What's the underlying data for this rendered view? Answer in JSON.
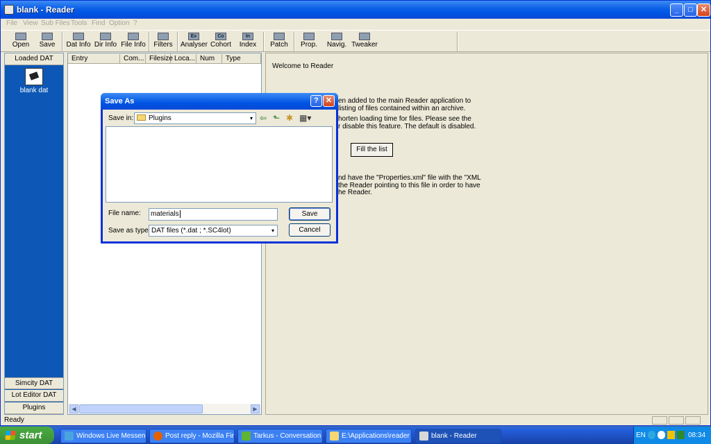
{
  "window": {
    "title": "blank - Reader",
    "min": "_",
    "max": "□",
    "close": "✕"
  },
  "menu": [
    "File",
    "View",
    "Sub Files",
    "Tools",
    "Find",
    "Option",
    "?"
  ],
  "toolbar": [
    {
      "label": "Open",
      "icon": "open-icon"
    },
    {
      "label": "Save",
      "icon": "save-icon"
    },
    {
      "label": "Dat Info",
      "icon": "dat-info-icon"
    },
    {
      "label": "Dir Info",
      "icon": "dir-info-icon"
    },
    {
      "label": "File Info",
      "icon": "file-info-icon"
    },
    {
      "label": "Filters",
      "icon": "filters-icon"
    },
    {
      "label": "Analyser",
      "icon": "analyser-icon",
      "glyph": "Ex"
    },
    {
      "label": "Cohort",
      "icon": "cohort-icon",
      "glyph": "Co"
    },
    {
      "label": "Index",
      "icon": "index-icon",
      "glyph": "In"
    },
    {
      "label": "Patch",
      "icon": "patch-icon"
    },
    {
      "label": "Prop.",
      "icon": "properties-icon"
    },
    {
      "label": "Navig.",
      "icon": "navigator-icon"
    },
    {
      "label": "Tweaker",
      "icon": "tweaker-icon"
    }
  ],
  "left_panel": {
    "header": "Loaded DAT",
    "item": "blank dat",
    "bottom": [
      "Simcity DAT",
      "Lot Editor DAT",
      "Plugins"
    ]
  },
  "list": {
    "columns": [
      "Entry",
      "Com...",
      "Filesize",
      "Loca...",
      "Num",
      "Type"
    ],
    "scroll_left": "◀",
    "scroll_right": "▶"
  },
  "info": {
    "welcome": "Welcome to Reader",
    "lines": [
      "en added to the main Reader application to",
      "listing of files contained within an archive.",
      "horten loading time for files. Please see the",
      "r disable this feature. The default is disabled.",
      "nd have the \"Properties.xml\" file with the \"XML",
      "the Reader pointing to this file in order to have",
      "he Reader."
    ],
    "fill_button": "Fill the list"
  },
  "status": "Ready",
  "dialog": {
    "title": "Save As",
    "help": "?",
    "close": "✕",
    "save_in_label": "Save in:",
    "save_in_value": "Plugins",
    "file_name_label": "File name:",
    "file_name_value": "materials",
    "save_type_label": "Save as type:",
    "save_type_value": "DAT files (*.dat ; *.SC4lot)",
    "save": "Save",
    "cancel": "Cancel",
    "nav": {
      "back": "⇦",
      "up": "⬑",
      "new_folder": "✱",
      "views": "▦▾"
    },
    "dropdown_arrow": "▾"
  },
  "taskbar": {
    "start": "start",
    "tasks": [
      {
        "label": "Windows Live Messen...",
        "icon": "messenger-icon",
        "color": "#4aa3df"
      },
      {
        "label": "Post reply - Mozilla Fir...",
        "icon": "firefox-icon",
        "color": "#e66000"
      },
      {
        "label": "Tarkus - Conversation",
        "icon": "conversation-icon",
        "color": "#5fb336"
      },
      {
        "label": "E:\\Applications\\reader",
        "icon": "folder-icon",
        "color": "#f7d774"
      },
      {
        "label": "blank - Reader",
        "icon": "reader-icon",
        "color": "#d8d8d8"
      }
    ],
    "lang": "EN",
    "clock": "08:34"
  }
}
